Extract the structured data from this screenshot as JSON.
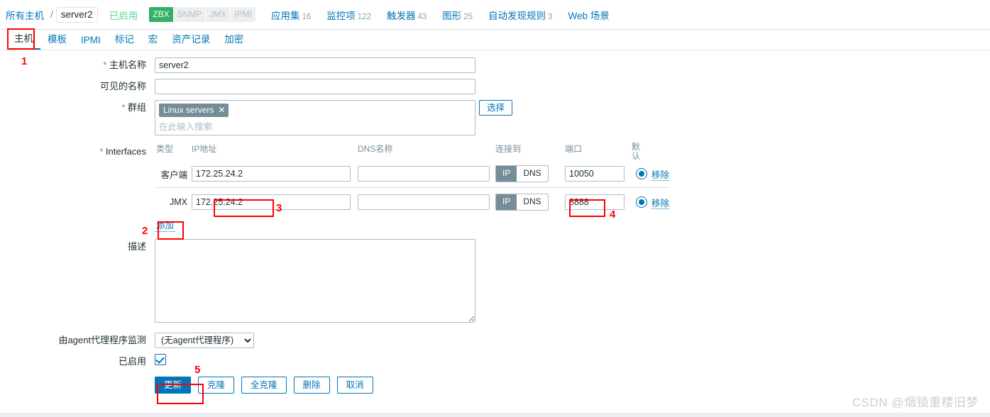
{
  "topnav": {
    "all_hosts": "所有主机",
    "separator": "/",
    "current_host": "server2",
    "status": "已启用",
    "interface_badges": [
      {
        "label": "ZBX",
        "active": true
      },
      {
        "label": "SNMP",
        "active": false
      },
      {
        "label": "JMX",
        "active": false
      },
      {
        "label": "IPMI",
        "active": false
      }
    ],
    "items": [
      {
        "label": "应用集",
        "count": "16"
      },
      {
        "label": "监控项",
        "count": "122"
      },
      {
        "label": "触发器",
        "count": "43"
      },
      {
        "label": "图形",
        "count": "25"
      },
      {
        "label": "自动发现规则",
        "count": "3"
      },
      {
        "label": "Web 场景",
        "count": ""
      }
    ]
  },
  "tabs": [
    {
      "label": "主机",
      "selected": true
    },
    {
      "label": "模板",
      "selected": false
    },
    {
      "label": "IPMI",
      "selected": false
    },
    {
      "label": "标记",
      "selected": false
    },
    {
      "label": "宏",
      "selected": false
    },
    {
      "label": "资产记录",
      "selected": false
    },
    {
      "label": "加密",
      "selected": false
    }
  ],
  "form": {
    "host_name": {
      "label": "主机名称",
      "required": true,
      "value": "server2"
    },
    "visible_name": {
      "label": "可见的名称",
      "required": false,
      "value": "",
      "placeholder": ""
    },
    "groups": {
      "label": "群组",
      "required": true,
      "chips": [
        "Linux servers"
      ],
      "chip_remove": "✕",
      "placeholder": "在此输入搜索",
      "select_button": "选择"
    },
    "interfaces": {
      "label": "Interfaces",
      "required": true,
      "headers": {
        "type": "类型",
        "ip": "IP地址",
        "dns": "DNS名称",
        "connect_to": "连接到",
        "port": "端口",
        "default_line1": "默",
        "default_line2": "认"
      },
      "rows": [
        {
          "type": "客户端",
          "ip": "172.25.24.2",
          "dns": "",
          "connect_ip": "IP",
          "connect_dns": "DNS",
          "connect_selected": "IP",
          "port": "10050",
          "default_selected": true,
          "remove_label": "移除"
        },
        {
          "type": "JMX",
          "ip": "172.25.24.2",
          "dns": "",
          "connect_ip": "IP",
          "connect_dns": "DNS",
          "connect_selected": "IP",
          "port": "8888",
          "default_selected": true,
          "remove_label": "移除"
        }
      ],
      "add_label": "添加"
    },
    "description": {
      "label": "描述",
      "value": "",
      "placeholder": ""
    },
    "monitored_by_proxy": {
      "label": "由agent代理程序监测",
      "selected": "(无agent代理程序)",
      "options": [
        "(无agent代理程序)"
      ]
    },
    "enabled": {
      "label": "已启用",
      "checked": true
    }
  },
  "buttons": [
    {
      "label": "更新",
      "primary": true
    },
    {
      "label": "克隆",
      "primary": false
    },
    {
      "label": "全克隆",
      "primary": false
    },
    {
      "label": "删除",
      "primary": false
    },
    {
      "label": "取消",
      "primary": false
    }
  ],
  "annotations": [
    {
      "num": "1"
    },
    {
      "num": "2"
    },
    {
      "num": "3"
    },
    {
      "num": "4"
    },
    {
      "num": "5"
    }
  ],
  "watermark": "CSDN @烟锁重楼旧梦",
  "colors": {
    "accent": "#0275b8",
    "enabled_green": "#59db8f",
    "badge_green": "#34af67",
    "required_red": "#e45959",
    "annotation_red": "#ff0000",
    "chip_gray": "#768d99"
  }
}
